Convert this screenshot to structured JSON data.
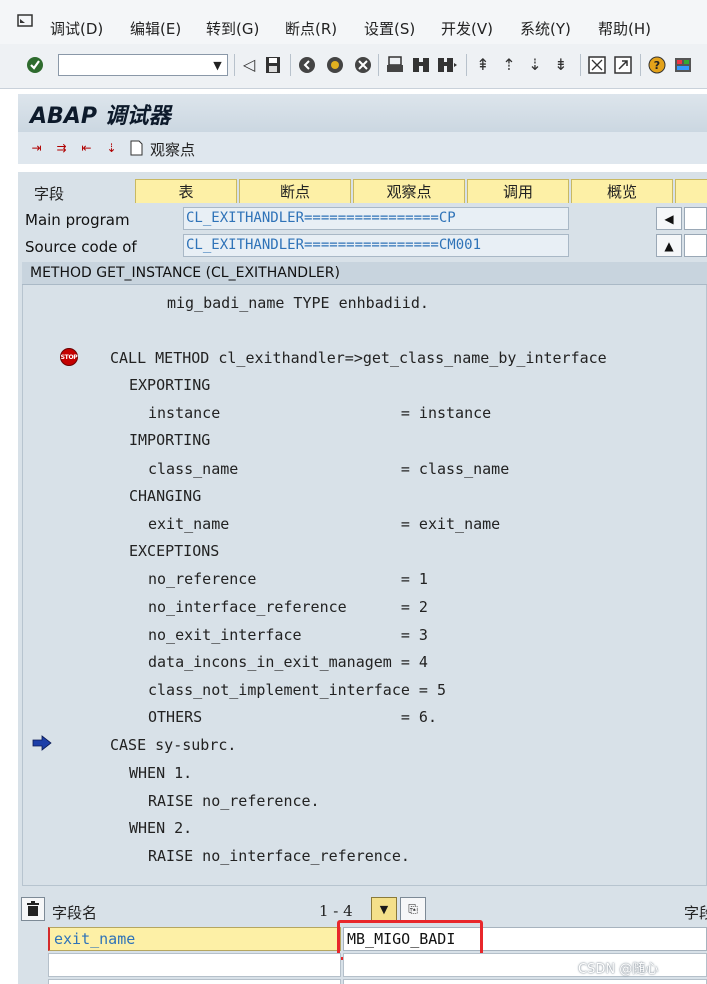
{
  "menu": {
    "items": [
      "调试(D)",
      "编辑(E)",
      "转到(G)",
      "断点(R)",
      "设置(S)",
      "开发(V)",
      "系统(Y)",
      "帮助(H)"
    ]
  },
  "toolbar": {
    "command_value": "",
    "icons": [
      "check-icon",
      "back-icon",
      "save-icon",
      "exit-icon",
      "cancel-icon",
      "print-icon",
      "find-icon",
      "find-next-icon",
      "first-page-icon",
      "prev-page-icon",
      "next-page-icon",
      "last-page-icon",
      "new-session-icon",
      "shortcut-icon",
      "help-icon",
      "layout-icon"
    ]
  },
  "app": {
    "title": "ABAP 调试器",
    "watchpoint_label": "观察点"
  },
  "tabs": {
    "label": "字段",
    "items": [
      "表",
      "断点",
      "观察点",
      "调用",
      "概览"
    ]
  },
  "header": {
    "main_program_label": "Main program",
    "main_program_value": "CL_EXITHANDLER================CP",
    "source_code_label": "Source code of",
    "source_code_value": "CL_EXITHANDLER================CM001"
  },
  "code": {
    "method_header": "METHOD GET_INSTANCE (CL_EXITHANDLER)",
    "stop_icon_text": "STOP",
    "lines": [
      "mig_badi_name TYPE enhbadiid.",
      "CALL METHOD cl_exithandler=>get_class_name_by_interface",
      "EXPORTING",
      "instance                    = instance",
      "IMPORTING",
      "class_name                  = class_name",
      "CHANGING",
      "exit_name                   = exit_name",
      "EXCEPTIONS",
      "no_reference                = 1",
      "no_interface_reference      = 2",
      "no_exit_interface           = 3",
      "data_incons_in_exit_managem = 4",
      "class_not_implement_interface = 5",
      "OTHERS                      = 6.",
      "CASE sy-subrc.",
      "WHEN 1.",
      "RAISE no_reference.",
      "WHEN 2.",
      "RAISE no_interface_reference."
    ]
  },
  "variables": {
    "column_label": "字段名",
    "range": "1 - 4",
    "right_column_label": "字段",
    "row1_name": "exit_name",
    "row1_value": "MB_MIGO_BADI"
  },
  "watermark": "CSDN @随心"
}
